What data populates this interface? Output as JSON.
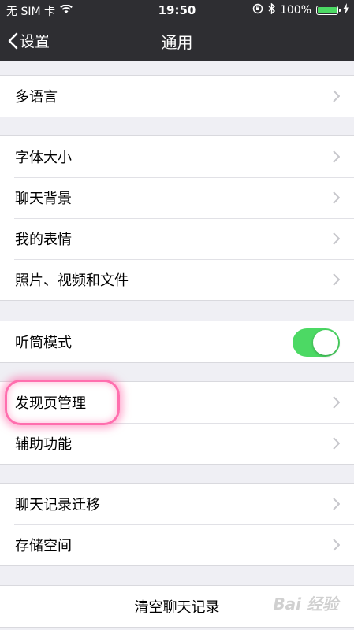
{
  "status_bar": {
    "carrier": "无 SIM 卡",
    "time": "19:50",
    "battery": "100%",
    "battery_level": 1.0
  },
  "nav": {
    "back_label": "设置",
    "title": "通用"
  },
  "groups": [
    {
      "items": [
        {
          "label": "多语言"
        }
      ]
    },
    {
      "items": [
        {
          "label": "字体大小"
        },
        {
          "label": "聊天背景"
        },
        {
          "label": "我的表情"
        },
        {
          "label": "照片、视频和文件"
        }
      ]
    },
    {
      "items": [
        {
          "label": "听筒模式",
          "toggle": true
        }
      ]
    },
    {
      "items": [
        {
          "label": "发现页管理"
        },
        {
          "label": "辅助功能"
        }
      ]
    },
    {
      "items": [
        {
          "label": "聊天记录迁移"
        },
        {
          "label": "存储空间"
        }
      ]
    },
    {
      "items": [
        {
          "label": "清空聊天记录"
        }
      ]
    }
  ],
  "watermark": "Bai 经验",
  "colors": {
    "accent_green": "#4cd964",
    "highlight": "#ff6fae",
    "navbar": "#2e2e32"
  }
}
